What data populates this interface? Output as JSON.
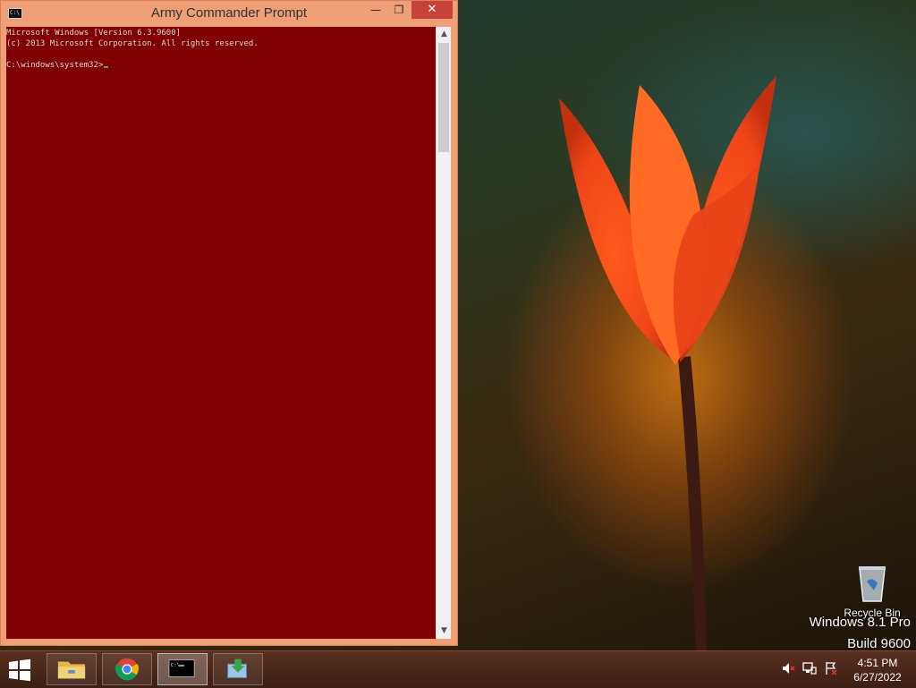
{
  "window": {
    "title": "Army Commander Prompt",
    "minimize_glyph": "—",
    "restore_glyph": "❐",
    "close_glyph": "✕",
    "console_bg": "#800000",
    "frame_color": "#ef9f76"
  },
  "console": {
    "lines": [
      "Microsoft Windows [Version 6.3.9600]",
      "(c) 2013 Microsoft Corporation. All rights reserved.",
      "",
      "C:\\windows\\system32>"
    ]
  },
  "desktop": {
    "recycle_bin_label": "Recycle Bin",
    "watermark_line1": "Windows 8.1 Pro",
    "watermark_line2": "Build 9600"
  },
  "taskbar": {
    "apps": [
      {
        "name": "File Explorer",
        "icon": "folder-icon",
        "active": false
      },
      {
        "name": "Google Chrome",
        "icon": "chrome-icon",
        "active": false
      },
      {
        "name": "Army Commander Prompt",
        "icon": "cmd-icon",
        "active": true
      },
      {
        "name": "App",
        "icon": "download-arrow-icon",
        "active": false
      }
    ],
    "tray_icons": [
      "speaker-muted-icon",
      "network-icon",
      "action-center-icon"
    ],
    "clock_time": "4:51 PM",
    "clock_date": "6/27/2022"
  }
}
